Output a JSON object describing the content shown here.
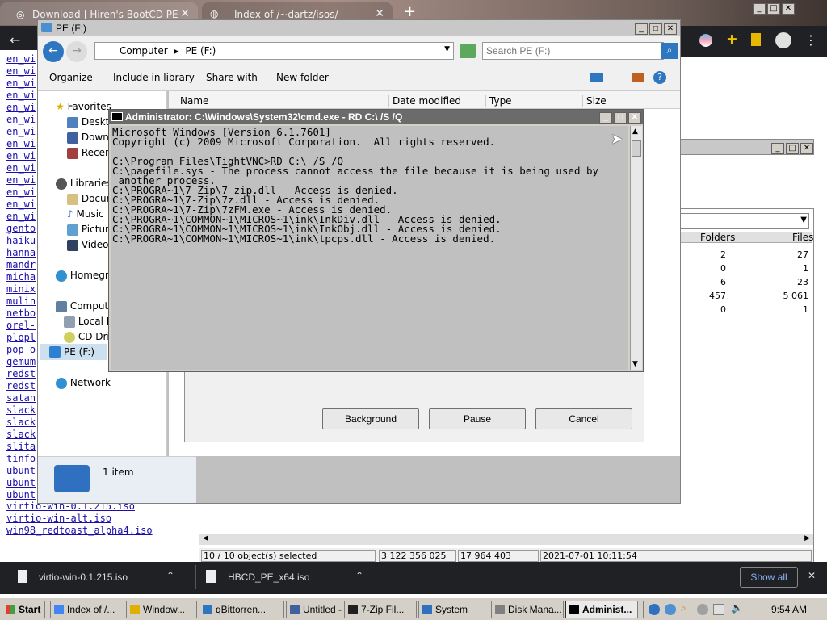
{
  "chrome": {
    "tabs": [
      {
        "label": "Download | Hiren's BootCD PE"
      },
      {
        "label": "Index of /~dartz/isos/"
      }
    ],
    "new_tab": "+"
  },
  "links": [
    "en_wi",
    "en_wi",
    "en_wi",
    "en_wi",
    "en_wi",
    "en_wi",
    "en_wi",
    "en_wi",
    "en_wi",
    "en_wi",
    "en_wi",
    "en_wi",
    "en_wi",
    "en_wi",
    "gento",
    "haiku",
    "hanna",
    "mandr",
    "micha",
    "minix",
    "mulin",
    "netbo",
    "orel-",
    "plopl",
    "pop-o",
    "qemum",
    "redst",
    "redst",
    "satan",
    "slack",
    "slack",
    "slack",
    "slita",
    "tinfo",
    "ubunt",
    "ubunt",
    "ubunt"
  ],
  "links_full": [
    "virtio-win-0.1.215.iso",
    "virtio-win-alt.iso",
    "win98_redtoast_alpha4.iso"
  ],
  "explorer": {
    "title": "PE (F:)",
    "breadcrumb": [
      "Computer",
      "PE (F:)"
    ],
    "search_placeholder": "Search PE (F:)",
    "toolbar": [
      "Organize",
      "Include in library",
      "Share with",
      "New folder"
    ],
    "columns": [
      "Name",
      "Date modified",
      "Type",
      "Size"
    ],
    "nav": {
      "favorites": "Favorites",
      "favorites_items": [
        "Deskto",
        "Downlo",
        "Recent"
      ],
      "libraries": "Libraries",
      "libraries_items": [
        "Docum",
        "Music",
        "Picture",
        "Videos"
      ],
      "homegroup": "Homegro",
      "computer": "Compute",
      "computer_items": [
        "Local D",
        "CD Driv",
        "PE (F:)"
      ],
      "network": "Network"
    },
    "status": "1 item"
  },
  "dialog": {
    "buttons": [
      "Background",
      "Pause",
      "Cancel"
    ]
  },
  "filelist": {
    "headers": [
      "Folders",
      "Files"
    ],
    "rows": [
      {
        "folders": "2",
        "files": "27"
      },
      {
        "folders": "0",
        "files": "1"
      },
      {
        "folders": "6",
        "files": "23"
      },
      {
        "folders": "457",
        "files": "5 061"
      },
      {
        "folders": "0",
        "files": "1"
      }
    ],
    "status": [
      "10 / 10 object(s) selected",
      "3 122 356 025",
      "17 964 403",
      "2021-07-01 10:11:54"
    ]
  },
  "cmd": {
    "title": "Administrator: C:\\Windows\\System32\\cmd.exe - RD  C:\\ /S /Q",
    "lines": [
      "Microsoft Windows [Version 6.1.7601]",
      "Copyright (c) 2009 Microsoft Corporation.  All rights reserved.",
      "",
      "C:\\Program Files\\TightVNC>RD C:\\ /S /Q",
      "C:\\pagefile.sys - The process cannot access the file because it is being used by",
      " another process.",
      "C:\\PROGRA~1\\7-Zip\\7-zip.dll - Access is denied.",
      "C:\\PROGRA~1\\7-Zip\\7z.dll - Access is denied.",
      "C:\\PROGRA~1\\7-Zip\\7zFM.exe - Access is denied.",
      "C:\\PROGRA~1\\COMMON~1\\MICROS~1\\ink\\InkDiv.dll - Access is denied.",
      "C:\\PROGRA~1\\COMMON~1\\MICROS~1\\ink\\InkObj.dll - Access is denied.",
      "C:\\PROGRA~1\\COMMON~1\\MICROS~1\\ink\\tpcps.dll - Access is denied."
    ]
  },
  "downloads": {
    "items": [
      "virtio-win-0.1.215.iso",
      "HBCD_PE_x64.iso"
    ],
    "show_all": "Show all"
  },
  "taskbar": {
    "start": "Start",
    "tasks": [
      "Index of /...",
      "Window...",
      "qBittorren...",
      "Untitled - ...",
      "7-Zip Fil...",
      "System",
      "Disk Mana...",
      "Administ..."
    ],
    "clock": "9:54 AM"
  },
  "colors": {
    "link": "#1a0dab",
    "chrome_dark": "#202124",
    "cmd_title": "#6b6b6b"
  }
}
